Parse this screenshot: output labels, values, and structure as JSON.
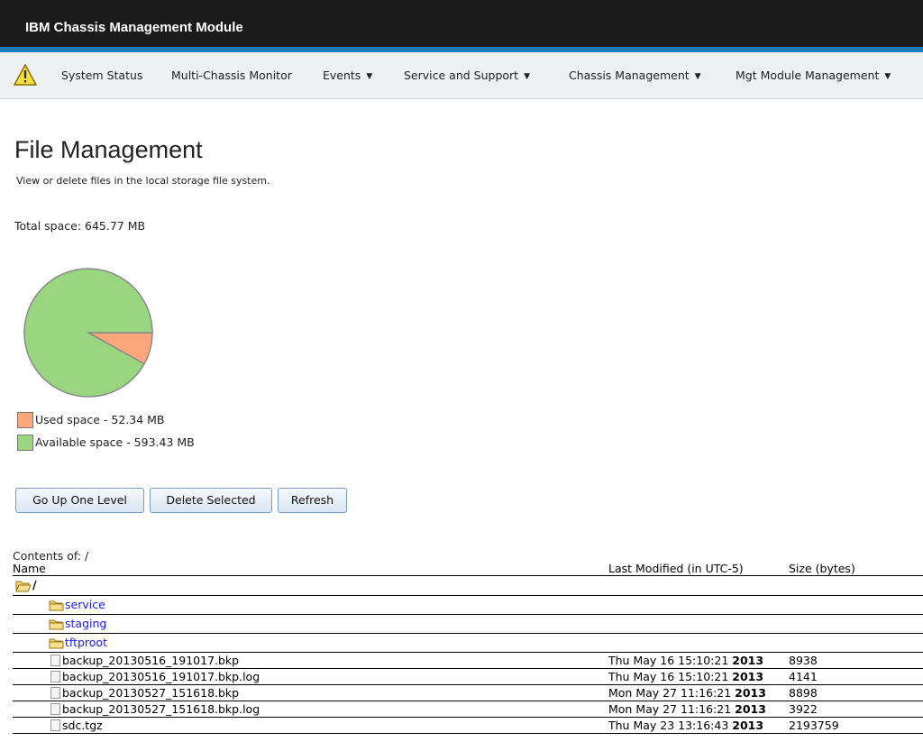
{
  "app": {
    "title": "IBM Chassis Management Module"
  },
  "nav": {
    "items": [
      {
        "label": "System Status"
      },
      {
        "label": "Multi-Chassis Monitor"
      },
      {
        "label": "Events"
      },
      {
        "label": "Service and Support"
      },
      {
        "label": "Chassis Management"
      },
      {
        "label": "Mgt Module Management"
      }
    ]
  },
  "page": {
    "title": "File Management",
    "description": "View or delete files in the local storage file system.",
    "total_space": "Total space: 645.77 MB"
  },
  "chart_data": {
    "type": "pie",
    "slices": [
      {
        "label": "Used space - 52.34 MB",
        "value": 52.34,
        "color": "#ffa77a"
      },
      {
        "label": "Available space - 593.43 MB",
        "value": 593.43,
        "color": "#99d67f"
      }
    ]
  },
  "buttons": {
    "go_up": "Go Up One Level",
    "delete": "Delete Selected",
    "refresh": "Refresh"
  },
  "table": {
    "contents_of": "Contents of: /",
    "headers": {
      "name": "Name",
      "modified": "Last Modified (in UTC-5)",
      "size": "Size (bytes)"
    },
    "root": "/",
    "folders": [
      {
        "name": "service"
      },
      {
        "name": "staging"
      },
      {
        "name": "tftproot"
      }
    ],
    "files": [
      {
        "name": "backup_20130516_191017.bkp",
        "date": "Thu May 16 15:10:21",
        "year": "2013",
        "size": "8938"
      },
      {
        "name": "backup_20130516_191017.bkp.log",
        "date": "Thu May 16 15:10:21",
        "year": "2013",
        "size": "4141"
      },
      {
        "name": "backup_20130527_151618.bkp",
        "date": "Mon May 27 11:16:21",
        "year": "2013",
        "size": "8898"
      },
      {
        "name": "backup_20130527_151618.bkp.log",
        "date": "Mon May 27 11:16:21",
        "year": "2013",
        "size": "3922"
      },
      {
        "name": "sdc.tgz",
        "date": "Thu May 23 13:16:43",
        "year": "2013",
        "size": "2193759"
      }
    ]
  },
  "colors": {
    "header_bg": "#1b1b1b",
    "accent": "#1d7ab8",
    "link": "#1a1aff"
  },
  "icons": {
    "warning": "warning-icon",
    "folder": "folder-icon",
    "file": "file-icon",
    "caret": "caret-down-icon"
  }
}
